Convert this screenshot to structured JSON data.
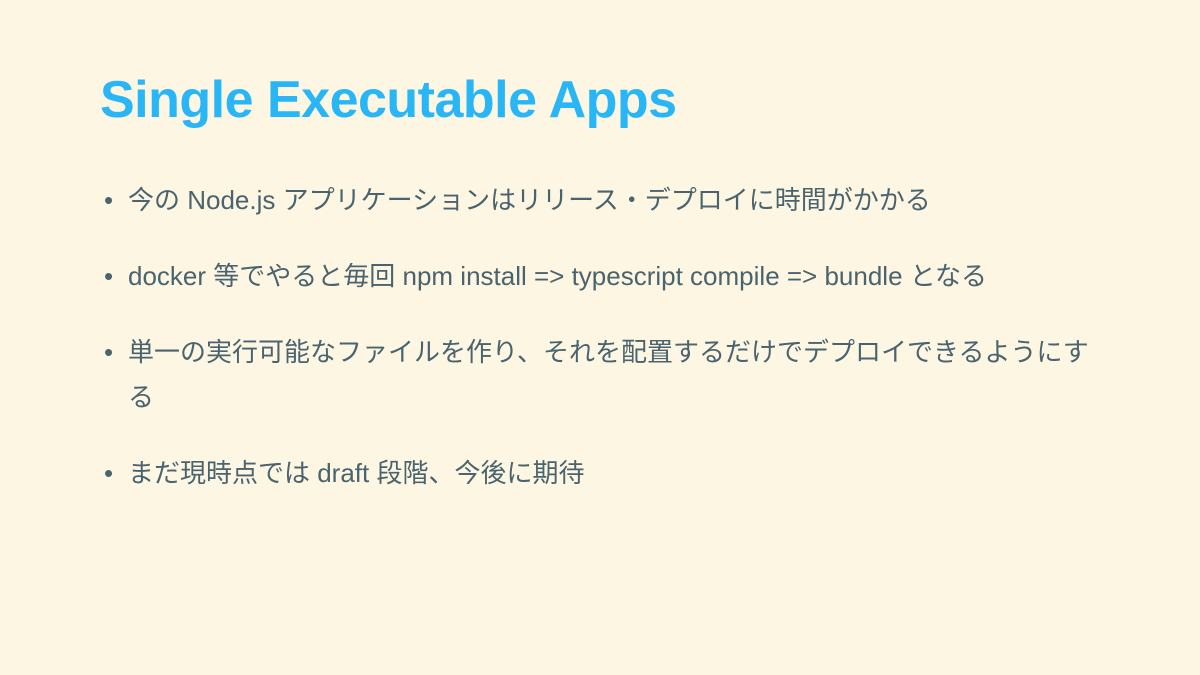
{
  "slide": {
    "title": "Single Executable Apps",
    "bullets": [
      "今の Node.js アプリケーションはリリース・デプロイに時間がかかる",
      "docker 等でやると毎回 npm install => typescript compile => bundle となる",
      "単一の実行可能なファイルを作り、それを配置するだけでデプロイできるようにする",
      "まだ現時点では draft 段階、今後に期待"
    ]
  }
}
